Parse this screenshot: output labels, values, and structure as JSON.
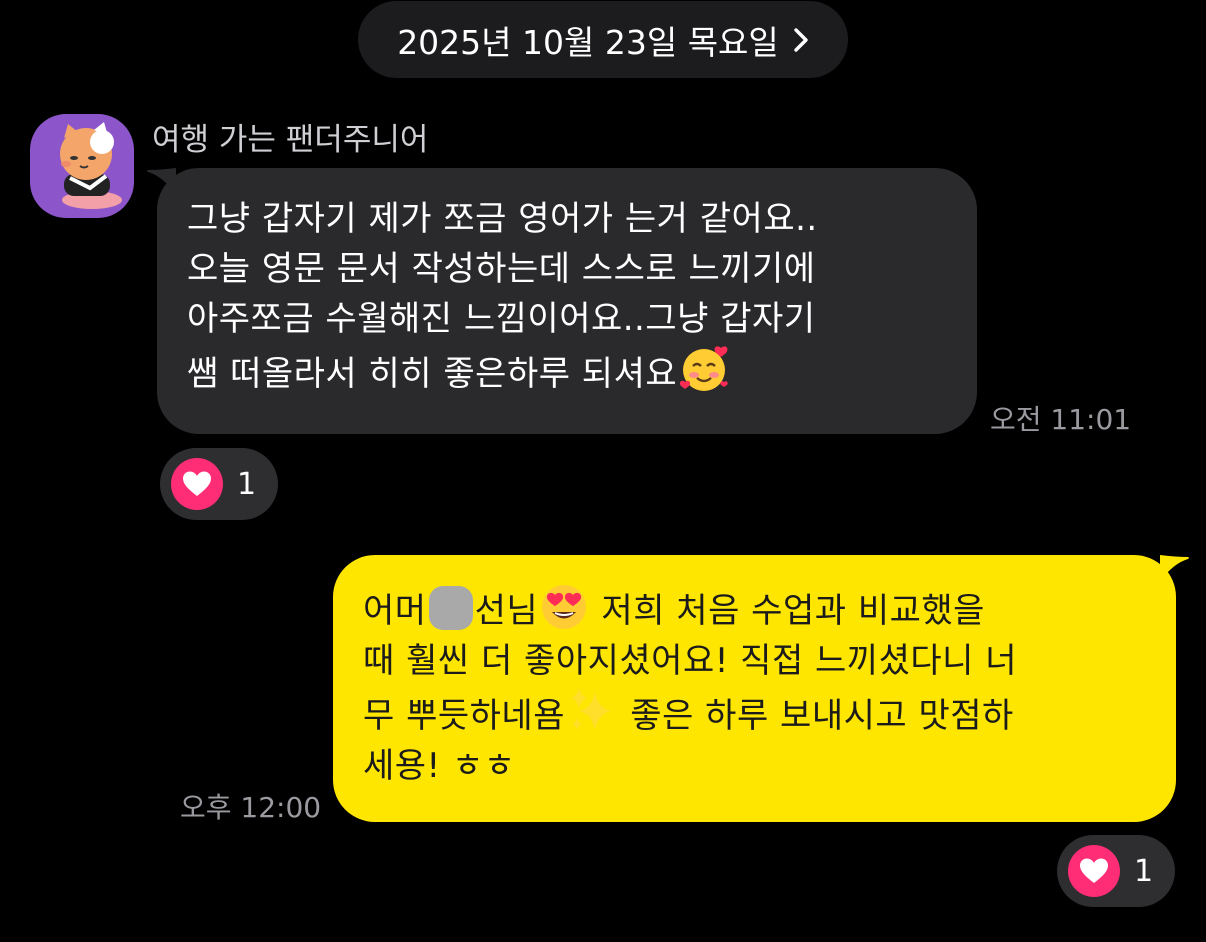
{
  "date_header": {
    "label": "2025년 10월 23일 목요일"
  },
  "incoming": {
    "sender_name": "여행 가는 팬더주니어",
    "lines": [
      "그냥 갑자기 제가 쪼금 영어가 는거 같어요..",
      "오늘 영문 문서 작성하는데 스스로 느끼기에",
      "아주쪼금 수월해진 느낌이어요..그냥 갑자기",
      "쌤 떠올라서 히히 좋은하루 되셔요"
    ],
    "time": "오전 11:01",
    "reaction": {
      "icon": "heart-icon",
      "count": "1"
    }
  },
  "outgoing": {
    "line1_a": "어머",
    "line1_b": "선님",
    "line1_c": " 저희 처음 수업과 비교했을",
    "line2": "때 훨씬 더 좋아지셨어요! 직접 느끼셨다니 너",
    "line3_a": "무 뿌듯하네욤",
    "line3_b": " 좋은 하루 보내시고 맛점하",
    "line4": "세용! ㅎㅎ",
    "time": "오후 12:00",
    "reaction": {
      "icon": "heart-icon",
      "count": "1"
    }
  },
  "colors": {
    "background": "#000000",
    "incoming_bubble": "#2a2a2c",
    "outgoing_bubble": "#ffe600",
    "reaction_heart": "#ff2d75"
  }
}
